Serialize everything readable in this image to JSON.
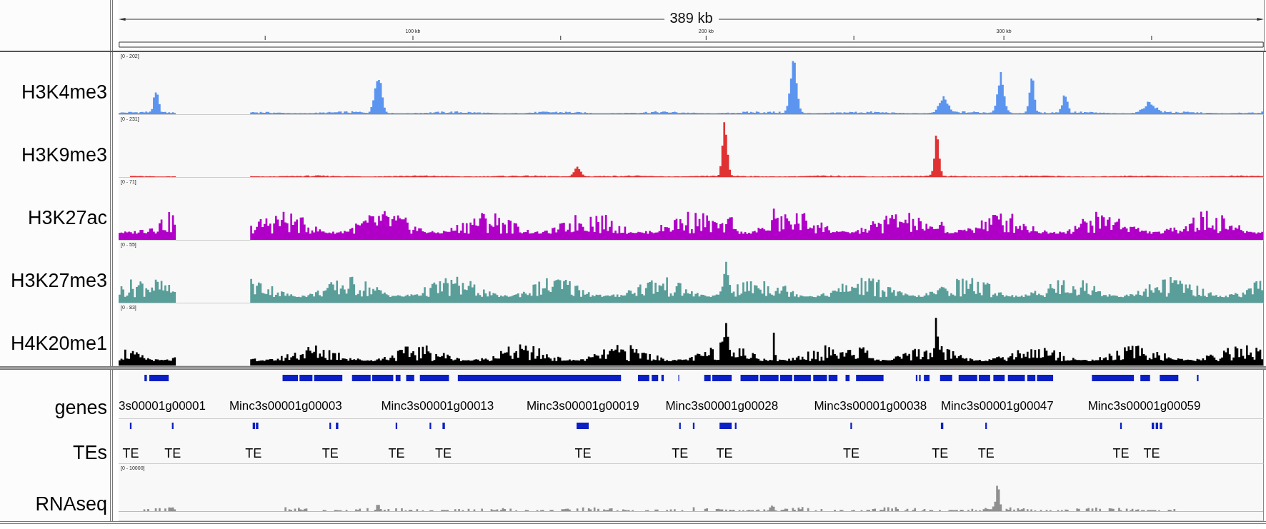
{
  "ruler": {
    "span": "389 kb",
    "ticks": [
      "100 kb",
      "200 kb",
      "300 kb"
    ]
  },
  "data_panel": {
    "tracks": [
      {
        "kind": "signal",
        "name": "H3K4me3",
        "range": "[0 - 202]",
        "color": "#5b95f0"
      },
      {
        "kind": "signal",
        "name": "H3K9me3",
        "range": "[0 - 231]",
        "color": "#e03232"
      },
      {
        "kind": "signal",
        "name": "H3K27ac",
        "range": "[0 - 71]",
        "color": "#b000c8"
      },
      {
        "kind": "signal",
        "name": "H3K27me3",
        "range": "[0 - 55]",
        "color": "#5a9e9a"
      },
      {
        "kind": "signal",
        "name": "H4K20me1",
        "range": "[0 - 83]",
        "color": "#000000"
      }
    ]
  },
  "feature_panel": {
    "tracks": [
      {
        "kind": "genes",
        "name": "genes",
        "labels": [
          "3s00001g00001",
          "Minc3s00001g00003",
          "Minc3s00001g00013",
          "Minc3s00001g00019",
          "Minc3s00001g00028",
          "Minc3s00001g00038",
          "Minc3s00001g00047",
          "Minc3s00001g00059"
        ]
      },
      {
        "kind": "elements",
        "name": "TEs",
        "labels": [
          "TE",
          "TE",
          "TE",
          "TE",
          "TE",
          "TE",
          "TE",
          "TE",
          "TE",
          "TE",
          "TE",
          "TE",
          "TE",
          "TE"
        ]
      },
      {
        "kind": "signal",
        "name": "RNAseq",
        "range": "[0 - 10000]",
        "color": "#909090"
      }
    ]
  }
}
